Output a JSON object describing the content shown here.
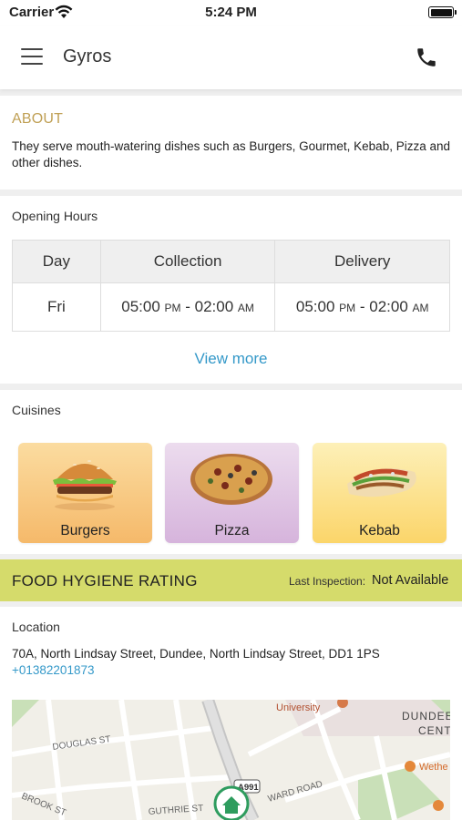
{
  "status_bar": {
    "carrier": "Carrier",
    "time": "5:24 PM"
  },
  "nav": {
    "title": "Gyros"
  },
  "about": {
    "title": "ABOUT",
    "text": "They serve mouth-watering dishes such as Burgers, Gourmet, Kebab, Pizza and other dishes."
  },
  "opening_hours": {
    "label": "Opening Hours",
    "headers": [
      "Day",
      "Collection",
      "Delivery"
    ],
    "rows": [
      {
        "day": "Fri",
        "collection": {
          "open": "05:00",
          "open_suffix": "PM",
          "sep": " - ",
          "close": "02:00",
          "close_suffix": "AM"
        },
        "delivery": {
          "open": "05:00",
          "open_suffix": "PM",
          "sep": " - ",
          "close": "02:00",
          "close_suffix": "AM"
        }
      }
    ],
    "view_more": "View more"
  },
  "cuisines": {
    "label": "Cuisines",
    "items": [
      {
        "name": "Burgers",
        "icon": "burger-image"
      },
      {
        "name": "Pizza",
        "icon": "pizza-image"
      },
      {
        "name": "Kebab",
        "icon": "kebab-image"
      }
    ]
  },
  "hygiene": {
    "title": "FOOD HYGIENE RATING",
    "last_inspection_label": "Last Inspection:",
    "last_inspection_value": "Not Available",
    "color": "#d5db6b"
  },
  "location": {
    "label": "Location",
    "address": "70A, North Lindsay Street, Dundee, North Lindsay Street, DD1 1PS",
    "phone": "+01382201873",
    "map_labels": {
      "university": "University",
      "dundee": "DUNDEE",
      "centre": "CENT",
      "douglas": "DOUGLAS ST",
      "ward": "WARD ROAD",
      "brook": "BROOK ST",
      "guthrie": "GUTHRIE ST",
      "road_no": "A991",
      "wether": "Wethe"
    }
  },
  "colors": {
    "accent": "#3599c9",
    "about_title": "#c0a055"
  }
}
